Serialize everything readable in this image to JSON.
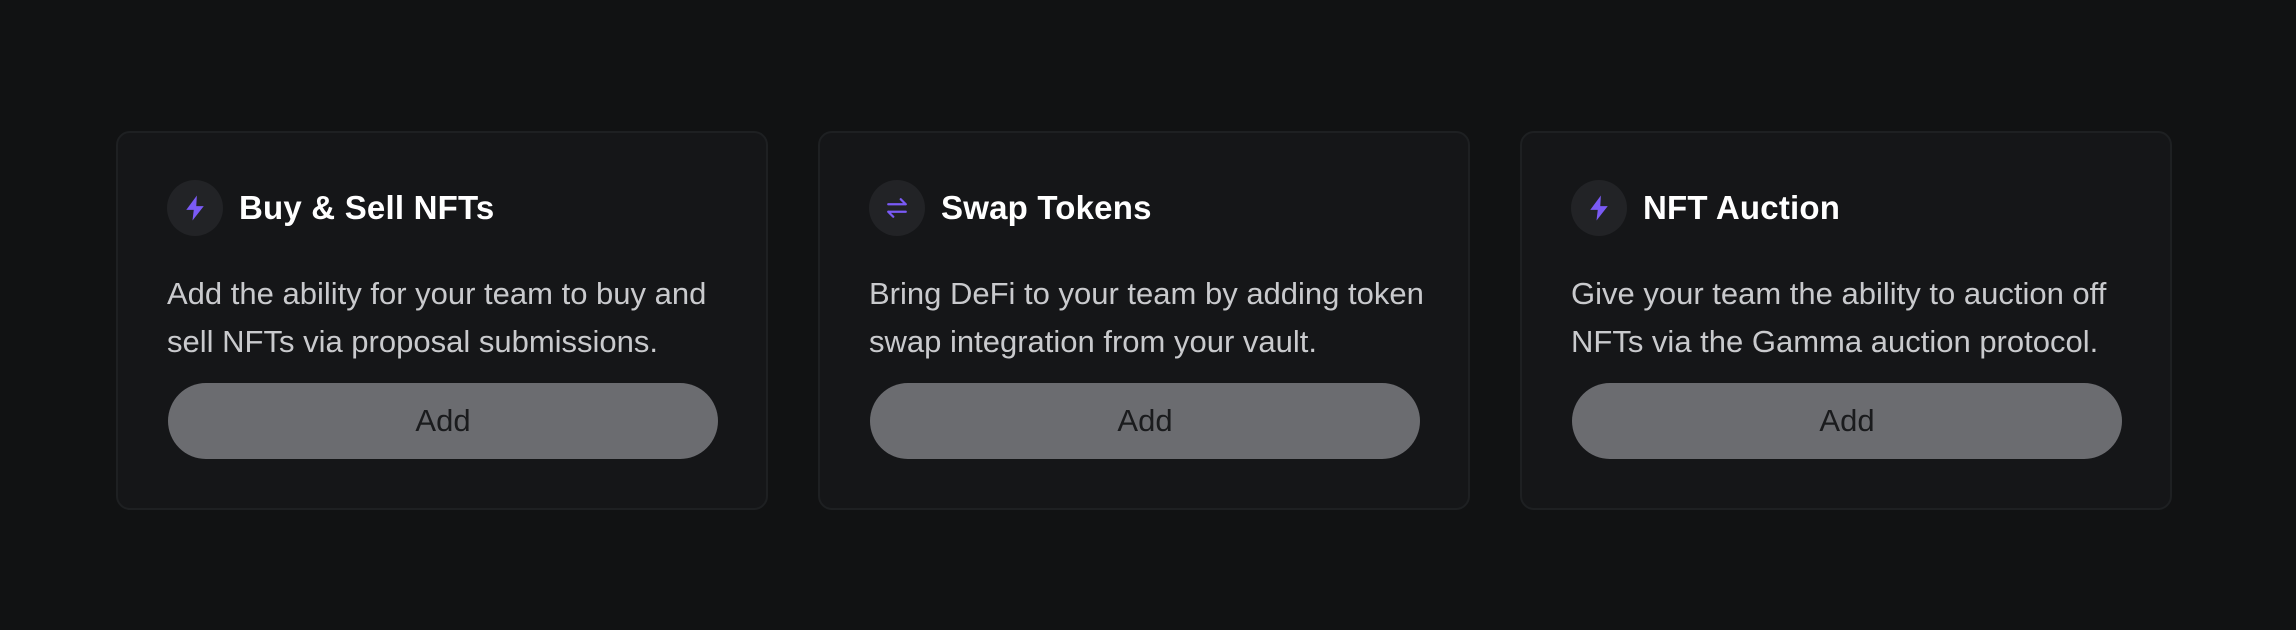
{
  "accent_color": "#7a5af5",
  "cards": [
    {
      "icon": "lightning-bolt-icon",
      "title": "Buy & Sell NFTs",
      "description": "Add the ability for your team to buy and sell NFTs via proposal submissions.",
      "button_label": "Add"
    },
    {
      "icon": "swap-arrows-icon",
      "title": "Swap Tokens",
      "description": "Bring DeFi to your team by adding token swap integration from your vault.",
      "button_label": "Add"
    },
    {
      "icon": "lightning-bolt-icon",
      "title": "NFT Auction",
      "description": "Give your team the ability to auction off NFTs via the Gamma auction protocol.",
      "button_label": "Add"
    }
  ]
}
